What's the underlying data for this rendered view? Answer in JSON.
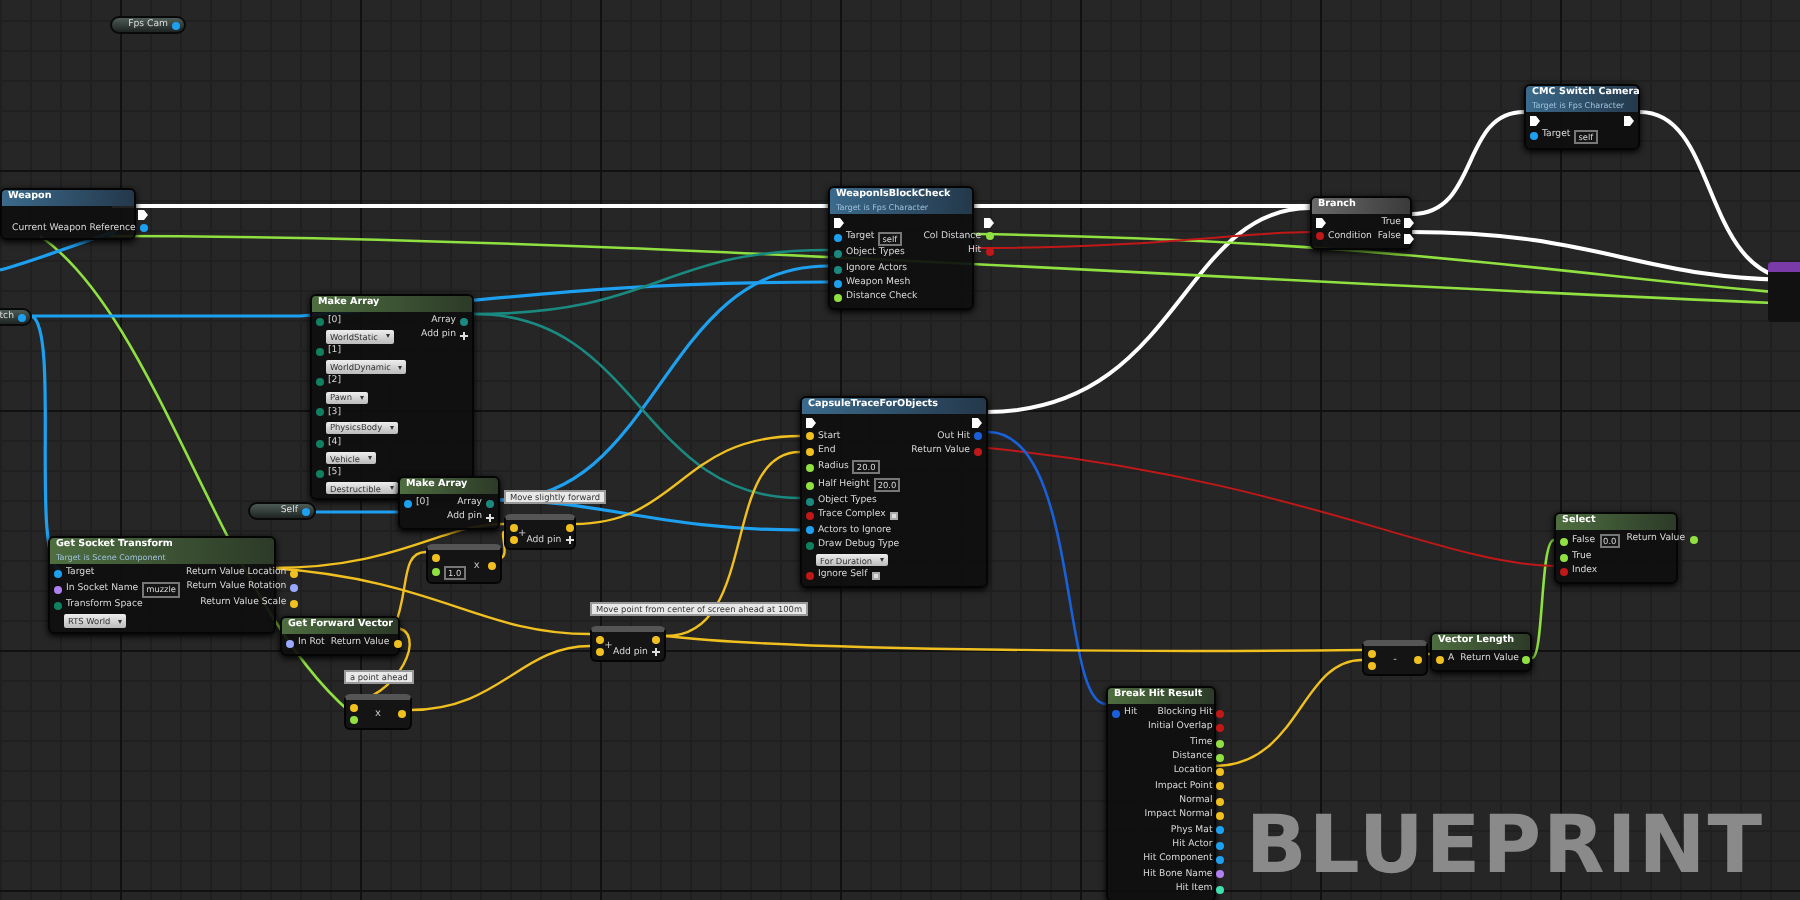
{
  "graph_label": "BLUEPRINT",
  "nodes": [
    {
      "kind": "pill",
      "title": "Fps Cam"
    },
    {
      "kind": "function",
      "title": "Weapon",
      "outputs": [
        {
          "kind": "exec"
        },
        {
          "label": "Current Weapon Reference",
          "kind": "object"
        }
      ]
    },
    {
      "kind": "pill",
      "title": "tch"
    },
    {
      "kind": "pure",
      "title": "Make Array",
      "inputs": [
        {
          "label": "[0]",
          "kind": "enum",
          "dropdown": "WorldStatic"
        },
        {
          "label": "[1]",
          "kind": "enum",
          "dropdown": "WorldDynamic"
        },
        {
          "label": "[2]",
          "kind": "enum",
          "dropdown": "Pawn"
        },
        {
          "label": "[3]",
          "kind": "enum",
          "dropdown": "PhysicsBody"
        },
        {
          "label": "[4]",
          "kind": "enum",
          "dropdown": "Vehicle"
        },
        {
          "label": "[5]",
          "kind": "enum",
          "dropdown": "Destructible"
        }
      ],
      "outputs": [
        {
          "label": "Array",
          "kind": "array"
        },
        {
          "label": "Add pin",
          "kind": "addpin"
        }
      ]
    },
    {
      "kind": "pure",
      "title": "Make Array",
      "inputs": [
        {
          "label": "[0]",
          "kind": "object"
        }
      ],
      "outputs": [
        {
          "label": "Array",
          "kind": "array"
        },
        {
          "label": "Add pin",
          "kind": "addpin"
        }
      ]
    },
    {
      "kind": "pill",
      "title": "Self"
    },
    {
      "kind": "function",
      "title": "WeaponIsBlockCheck",
      "subtitle": "Target is Fps Character",
      "inputs": [
        {
          "kind": "exec"
        },
        {
          "label": "Target",
          "kind": "object",
          "value": "self"
        },
        {
          "label": "Object Types",
          "kind": "array"
        },
        {
          "label": "Ignore Actors",
          "kind": "array"
        },
        {
          "label": "Weapon Mesh",
          "kind": "object"
        },
        {
          "label": "Distance Check",
          "kind": "float"
        }
      ],
      "outputs": [
        {
          "kind": "exec"
        },
        {
          "label": "Col Distance",
          "kind": "float"
        },
        {
          "label": "Hit",
          "kind": "bool"
        }
      ]
    },
    {
      "kind": "flow",
      "title": "Branch",
      "inputs": [
        {
          "kind": "exec"
        },
        {
          "label": "Condition",
          "kind": "bool"
        }
      ],
      "outputs": [
        {
          "label": "True",
          "kind": "exec"
        },
        {
          "label": "False",
          "kind": "exec"
        }
      ]
    },
    {
      "kind": "function",
      "title": "CMC Switch Camera",
      "subtitle": "Target is Fps Character",
      "inputs": [
        {
          "kind": "exec"
        },
        {
          "label": "Target",
          "kind": "object",
          "value": "self"
        }
      ],
      "outputs": [
        {
          "kind": "exec"
        }
      ]
    },
    {
      "kind": "function",
      "title": "CapsuleTraceForObjects",
      "inputs": [
        {
          "kind": "exec"
        },
        {
          "label": "Start",
          "kind": "vector"
        },
        {
          "label": "End",
          "kind": "vector"
        },
        {
          "label": "Radius",
          "kind": "float",
          "value": "20.0"
        },
        {
          "label": "Half Height",
          "kind": "float",
          "value": "20.0"
        },
        {
          "label": "Object Types",
          "kind": "array"
        },
        {
          "label": "Trace Complex",
          "kind": "bool",
          "checked": true
        },
        {
          "label": "Actors to Ignore",
          "kind": "object"
        },
        {
          "label": "Draw Debug Type",
          "kind": "enum",
          "dropdown": "For Duration"
        },
        {
          "label": "Ignore Self",
          "kind": "bool",
          "checked": true
        }
      ],
      "outputs": [
        {
          "kind": "exec"
        },
        {
          "label": "Out Hit",
          "kind": "struct"
        },
        {
          "label": "Return Value",
          "kind": "bool"
        }
      ]
    },
    {
      "kind": "op",
      "symbol": "+",
      "comment": "Move slightly forward",
      "inputs": [
        {
          "kind": "vector"
        },
        {
          "kind": "vector"
        }
      ],
      "outputs": [
        {
          "kind": "vector"
        },
        {
          "label": "Add pin",
          "kind": "addpin"
        }
      ]
    },
    {
      "kind": "pure",
      "title": "Get Socket Transform",
      "subtitle": "Target is Scene Component",
      "inputs": [
        {
          "label": "Target",
          "kind": "object"
        },
        {
          "label": "In Socket Name",
          "kind": "name",
          "value": "muzzle"
        },
        {
          "label": "Transform Space",
          "kind": "enum",
          "dropdown": "RTS World"
        }
      ],
      "outputs": [
        {
          "label": "Return Value Location",
          "kind": "vector"
        },
        {
          "label": "Return Value Rotation",
          "kind": "rotator"
        },
        {
          "label": "Return Value Scale",
          "kind": "vector"
        }
      ]
    },
    {
      "kind": "op",
      "symbol": "x",
      "inputs": [
        {
          "kind": "vector"
        },
        {
          "kind": "float",
          "value": "1.0"
        }
      ],
      "outputs": [
        {
          "kind": "vector"
        }
      ]
    },
    {
      "kind": "pure",
      "title": "Get Forward Vector",
      "inputs": [
        {
          "label": "In Rot",
          "kind": "rotator"
        }
      ],
      "outputs": [
        {
          "label": "Return Value",
          "kind": "vector"
        }
      ]
    },
    {
      "kind": "op",
      "symbol": "+",
      "comment": "Move point from center of screen ahead at 100m",
      "inputs": [
        {
          "kind": "vector"
        },
        {
          "kind": "vector"
        }
      ],
      "outputs": [
        {
          "kind": "vector"
        },
        {
          "label": "Add pin",
          "kind": "addpin"
        }
      ]
    },
    {
      "kind": "op",
      "symbol": "x",
      "comment": "a point ahead",
      "inputs": [
        {
          "kind": "vector"
        },
        {
          "kind": "float"
        }
      ],
      "outputs": [
        {
          "kind": "vector"
        }
      ]
    },
    {
      "kind": "op",
      "symbol": "-",
      "inputs": [
        {
          "kind": "vector"
        },
        {
          "kind": "vector"
        }
      ],
      "outputs": [
        {
          "kind": "vector"
        }
      ]
    },
    {
      "kind": "pure",
      "title": "Vector Length",
      "inputs": [
        {
          "label": "A",
          "kind": "vector"
        }
      ],
      "outputs": [
        {
          "label": "Return Value",
          "kind": "float"
        }
      ]
    },
    {
      "kind": "pure",
      "title": "Select",
      "inputs": [
        {
          "label": "False",
          "kind": "float",
          "value": "0.0"
        },
        {
          "label": "True",
          "kind": "float"
        },
        {
          "label": "Index",
          "kind": "bool"
        }
      ],
      "outputs": [
        {
          "label": "Return Value",
          "kind": "float"
        }
      ]
    },
    {
      "kind": "pure",
      "title": "Break Hit Result",
      "inputs": [
        {
          "label": "Hit",
          "kind": "struct"
        }
      ],
      "outputs": [
        {
          "label": "Blocking Hit",
          "kind": "bool"
        },
        {
          "label": "Initial Overlap",
          "kind": "bool"
        },
        {
          "label": "Time",
          "kind": "float"
        },
        {
          "label": "Distance",
          "kind": "float"
        },
        {
          "label": "Location",
          "kind": "vector"
        },
        {
          "label": "Impact Point",
          "kind": "vector"
        },
        {
          "label": "Normal",
          "kind": "vector"
        },
        {
          "label": "Impact Normal",
          "kind": "vector"
        },
        {
          "label": "Phys Mat",
          "kind": "object"
        },
        {
          "label": "Hit Actor",
          "kind": "object"
        },
        {
          "label": "Hit Component",
          "kind": "object"
        },
        {
          "label": "Hit Bone Name",
          "kind": "name"
        },
        {
          "label": "Hit Item",
          "kind": "int"
        }
      ]
    }
  ]
}
